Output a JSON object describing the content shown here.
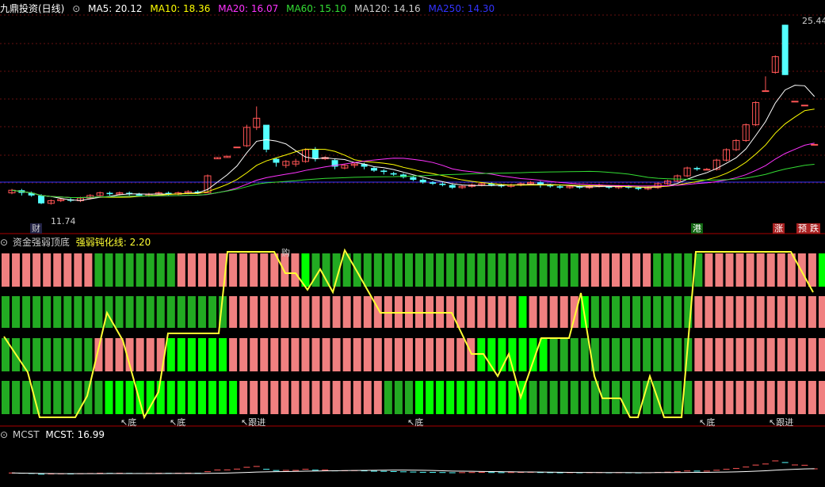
{
  "main_panel": {
    "stock_name": "九鼎投资(日线)",
    "ma_labels": [
      {
        "text": "MA5: 20.12",
        "color": "#ffffff"
      },
      {
        "text": "MA10: 18.36",
        "color": "#ffff00"
      },
      {
        "text": "MA20: 16.07",
        "color": "#ff33ff"
      },
      {
        "text": "MA60: 15.10",
        "color": "#33dd33"
      },
      {
        "text": "MA120: 14.16",
        "color": "#cccccc"
      },
      {
        "text": "MA250: 14.30",
        "color": "#3333ff"
      }
    ],
    "high_label": "25.44",
    "low_label": "11.74",
    "markers": {
      "cai": "财",
      "gang": "港",
      "zhang": "涨",
      "yu": "预",
      "die": "跌"
    }
  },
  "sub_panel_1": {
    "title": "资金强弱顶底",
    "line_label": "强弱钝化线: 2.20",
    "buy_marker": "购",
    "bottom_labels": [
      "底",
      "底",
      "跟进",
      "底",
      "底",
      "跟进"
    ]
  },
  "sub_panel_2": {
    "title": "MCST",
    "value_label": "MCST: 16.99"
  },
  "colors": {
    "up": "#ff5555",
    "down": "#54ffff",
    "pink_bar": "#f08080",
    "green_bar": "#22aa22",
    "bright_green_bar": "#00ff00",
    "strength_line": "#ffff33",
    "divider": "#aa0000"
  },
  "candles": [
    [
      0,
      12.6,
      12.8,
      12.5,
      12.9
    ],
    [
      1,
      12.8,
      12.6,
      12.4,
      12.9
    ],
    [
      2,
      12.6,
      12.4,
      12.3,
      12.7
    ],
    [
      3,
      12.4,
      11.8,
      11.74,
      12.5
    ],
    [
      4,
      11.8,
      12.0,
      11.7,
      12.1
    ],
    [
      5,
      12.0,
      12.1,
      11.9,
      12.2
    ],
    [
      6,
      12.1,
      12.0,
      11.9,
      12.2
    ],
    [
      7,
      12.0,
      12.2,
      11.9,
      12.3
    ],
    [
      8,
      12.2,
      12.4,
      12.1,
      12.5
    ],
    [
      9,
      12.4,
      12.6,
      12.3,
      12.7
    ],
    [
      10,
      12.6,
      12.5,
      12.4,
      12.7
    ],
    [
      11,
      12.5,
      12.6,
      12.4,
      12.7
    ],
    [
      12,
      12.6,
      12.5,
      12.4,
      12.7
    ],
    [
      13,
      12.5,
      12.4,
      12.3,
      12.6
    ],
    [
      14,
      12.4,
      12.5,
      12.3,
      12.6
    ],
    [
      15,
      12.5,
      12.6,
      12.4,
      12.7
    ],
    [
      16,
      12.6,
      12.5,
      12.4,
      12.7
    ],
    [
      17,
      12.5,
      12.6,
      12.4,
      12.7
    ],
    [
      18,
      12.6,
      12.7,
      12.5,
      12.8
    ],
    [
      19,
      12.7,
      12.6,
      12.5,
      12.8
    ],
    [
      20,
      12.6,
      13.9,
      12.6,
      14.0
    ],
    [
      21,
      15.2,
      15.3,
      15.2,
      15.3
    ],
    [
      22,
      15.3,
      15.4,
      15.3,
      15.4
    ],
    [
      23,
      16.1,
      16.1,
      16.1,
      16.1
    ],
    [
      24,
      16.2,
      17.6,
      16.1,
      17.8
    ],
    [
      25,
      17.6,
      18.3,
      17.4,
      19.2
    ],
    [
      26,
      17.8,
      15.9,
      15.7,
      16.0
    ],
    [
      27,
      15.2,
      14.9,
      14.6,
      15.3
    ],
    [
      28,
      14.7,
      15.0,
      14.5,
      15.1
    ],
    [
      29,
      14.8,
      15.0,
      14.6,
      15.2
    ],
    [
      30,
      15.0,
      15.9,
      14.9,
      16.0
    ],
    [
      31,
      15.9,
      15.2,
      15.0,
      16.1
    ],
    [
      32,
      15.2,
      15.3,
      15.1,
      15.4
    ],
    [
      33,
      15.1,
      14.6,
      14.4,
      15.2
    ],
    [
      34,
      14.5,
      14.7,
      14.4,
      14.8
    ],
    [
      35,
      14.7,
      14.8,
      14.5,
      14.9
    ],
    [
      36,
      14.8,
      14.6,
      14.4,
      14.9
    ],
    [
      37,
      14.5,
      14.3,
      14.2,
      14.6
    ],
    [
      38,
      14.3,
      14.2,
      14.0,
      14.4
    ],
    [
      39,
      14.1,
      14.0,
      13.9,
      14.2
    ],
    [
      40,
      14.0,
      13.8,
      13.7,
      14.1
    ],
    [
      41,
      13.8,
      13.6,
      13.5,
      13.9
    ],
    [
      42,
      13.6,
      13.4,
      13.3,
      13.7
    ],
    [
      43,
      13.4,
      13.3,
      13.2,
      13.5
    ],
    [
      44,
      13.3,
      13.2,
      13.1,
      13.4
    ],
    [
      45,
      13.2,
      13.0,
      12.9,
      13.3
    ],
    [
      46,
      13.0,
      13.1,
      12.9,
      13.2
    ],
    [
      47,
      13.1,
      13.2,
      13.0,
      13.3
    ],
    [
      48,
      13.2,
      13.3,
      13.1,
      13.4
    ],
    [
      49,
      13.3,
      13.2,
      13.1,
      13.4
    ],
    [
      50,
      13.2,
      13.1,
      13.0,
      13.3
    ],
    [
      51,
      13.1,
      13.2,
      13.0,
      13.3
    ],
    [
      52,
      13.2,
      13.3,
      13.1,
      13.4
    ],
    [
      53,
      13.3,
      13.4,
      13.2,
      13.5
    ],
    [
      54,
      13.4,
      13.2,
      13.0,
      13.5
    ],
    [
      55,
      13.2,
      13.1,
      13.0,
      13.3
    ],
    [
      56,
      13.1,
      13.0,
      12.9,
      13.2
    ],
    [
      57,
      13.0,
      13.1,
      12.9,
      13.2
    ],
    [
      58,
      13.1,
      13.0,
      12.9,
      13.2
    ],
    [
      59,
      13.0,
      13.1,
      12.9,
      13.2
    ],
    [
      60,
      13.1,
      13.2,
      13.0,
      13.3
    ],
    [
      61,
      13.1,
      13.0,
      12.9,
      13.2
    ],
    [
      62,
      13.0,
      13.1,
      12.9,
      13.2
    ],
    [
      63,
      13.1,
      13.0,
      12.9,
      13.2
    ],
    [
      64,
      13.0,
      12.9,
      12.8,
      13.1
    ],
    [
      65,
      12.9,
      13.0,
      12.8,
      13.1
    ],
    [
      66,
      13.0,
      13.3,
      12.9,
      13.4
    ],
    [
      67,
      13.3,
      13.5,
      13.2,
      13.6
    ],
    [
      68,
      13.5,
      13.9,
      13.4,
      14.0
    ],
    [
      69,
      13.9,
      14.5,
      13.8,
      14.6
    ],
    [
      70,
      14.5,
      14.4,
      14.3,
      14.6
    ],
    [
      71,
      14.4,
      14.4,
      14.4,
      14.5
    ],
    [
      72,
      14.4,
      15.1,
      14.3,
      15.2
    ],
    [
      73,
      15.1,
      15.9,
      15.0,
      16.0
    ],
    [
      74,
      15.9,
      16.6,
      15.8,
      16.7
    ],
    [
      75,
      16.6,
      17.8,
      16.5,
      17.9
    ],
    [
      76,
      17.8,
      19.5,
      17.7,
      19.6
    ],
    [
      77,
      20.4,
      20.4,
      20.4,
      21.5
    ],
    [
      78,
      21.8,
      23.0,
      21.7,
      23.1
    ],
    [
      79,
      25.44,
      21.6,
      21.6,
      25.44
    ],
    [
      80,
      19.6,
      19.6,
      19.6,
      19.6
    ],
    [
      81,
      19.3,
      19.3,
      19.3,
      19.3
    ],
    [
      82,
      16.3,
      16.3,
      16.3,
      16.3
    ]
  ]
}
